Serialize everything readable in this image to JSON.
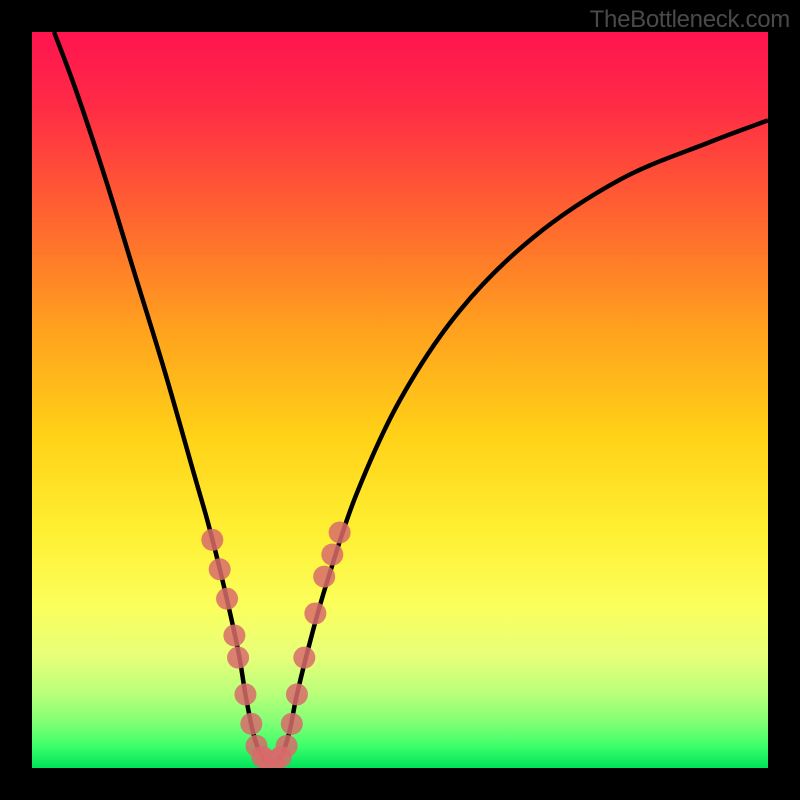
{
  "watermark": "TheBottleneck.com",
  "chart_data": {
    "type": "line",
    "title": "",
    "xlabel": "",
    "ylabel": "",
    "xlim": [
      0,
      100
    ],
    "ylim": [
      0,
      100
    ],
    "grid": false,
    "curve_points": {
      "x": [
        3,
        6,
        10,
        14,
        18,
        22,
        24,
        26,
        28,
        29,
        30,
        31,
        32,
        33,
        34,
        35,
        36,
        38,
        40,
        44,
        50,
        58,
        68,
        80,
        92,
        100
      ],
      "y": [
        100,
        92,
        80,
        67,
        54,
        40,
        33,
        25,
        16,
        10,
        5,
        2,
        1,
        1,
        2,
        5,
        10,
        18,
        25,
        37,
        50,
        62,
        72,
        80,
        85,
        88
      ]
    },
    "highlight_dots": {
      "x": [
        24.5,
        25.5,
        26.5,
        27.5,
        28.0,
        29.0,
        29.8,
        30.5,
        31.3,
        32.0,
        33.0,
        33.8,
        34.6,
        35.3,
        36.0,
        37.0,
        38.5,
        39.7,
        40.8,
        41.8
      ],
      "y": [
        31,
        27,
        23,
        18,
        15,
        10,
        6,
        3,
        1.5,
        1,
        1,
        1.5,
        3,
        6,
        10,
        15,
        21,
        26,
        29,
        32
      ]
    },
    "green_band_y_range": [
      0,
      4
    ],
    "background_gradient": {
      "stops": [
        {
          "pos": 0.0,
          "color": "#ff1450"
        },
        {
          "pos": 0.1,
          "color": "#ff2b45"
        },
        {
          "pos": 0.25,
          "color": "#ff6430"
        },
        {
          "pos": 0.4,
          "color": "#ffa01e"
        },
        {
          "pos": 0.55,
          "color": "#ffd217"
        },
        {
          "pos": 0.68,
          "color": "#fff033"
        },
        {
          "pos": 0.78,
          "color": "#fbff5c"
        },
        {
          "pos": 0.85,
          "color": "#e6ff79"
        },
        {
          "pos": 0.9,
          "color": "#b8ff7a"
        },
        {
          "pos": 0.94,
          "color": "#7dff74"
        },
        {
          "pos": 0.97,
          "color": "#3dff6a"
        },
        {
          "pos": 1.0,
          "color": "#00e35a"
        }
      ]
    },
    "dot_color": "#d86b6b",
    "curve_color": "#000000",
    "curve_width": 4.5,
    "dot_radius": 11
  }
}
